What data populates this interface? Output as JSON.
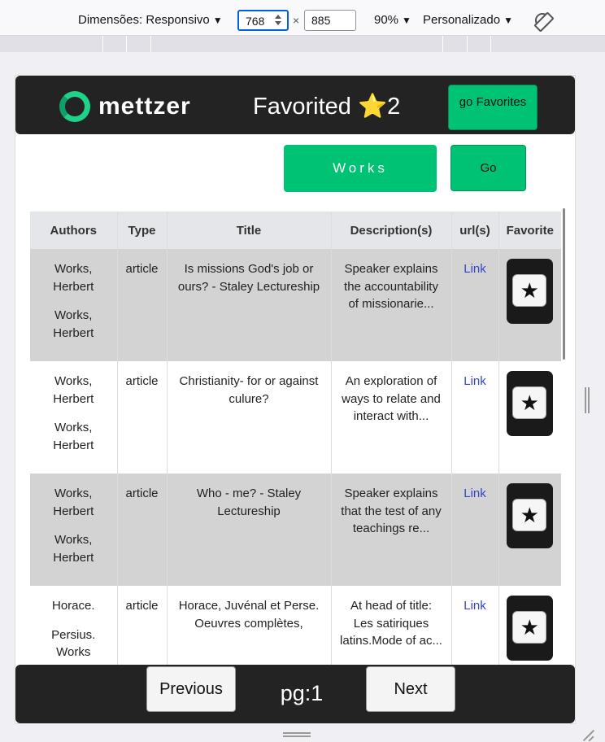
{
  "devtools": {
    "dimensions_label": "Dimensões: Responsivo",
    "width": "768",
    "height": "885",
    "times": "×",
    "zoom": "90%",
    "preset": "Personalizado",
    "caret": "▼"
  },
  "app": {
    "logo_text": "mettzer",
    "favorited_label": "Favorited",
    "favorited_star": "⭐",
    "favorited_count": "2",
    "go_favorites": "go Favorites",
    "search_value": "Works",
    "go_label": "Go"
  },
  "table": {
    "headers": [
      "Authors",
      "Type",
      "Title",
      "Description(s)",
      "url(s)",
      "Favorite"
    ],
    "rows": [
      {
        "authors": [
          "Works, Herbert",
          "Works, Herbert"
        ],
        "type": "article",
        "title": "Is missions God's job or ours? - Staley Lectureship",
        "description": "Speaker explains the accountability of missionarie...",
        "url": "Link",
        "fav_icon": "★"
      },
      {
        "authors": [
          "Works, Herbert",
          "Works, Herbert"
        ],
        "type": "article",
        "title": "Christianity- for or against culure?",
        "description": "An exploration of ways to relate and interact with...",
        "url": "Link",
        "fav_icon": "★"
      },
      {
        "authors": [
          "Works, Herbert",
          "Works, Herbert"
        ],
        "type": "article",
        "title": "Who - me? - Staley Lectureship",
        "description": "Speaker explains that the test of any teachings re...",
        "url": "Link",
        "fav_icon": "★"
      },
      {
        "authors": [
          "Horace.",
          "Persius. Works"
        ],
        "type": "article",
        "title": "Horace, Juvénal et Perse. Oeuvres complètes,",
        "description": "At head of title: Les satiriques latins.Mode of ac...",
        "url": "Link",
        "fav_icon": "★"
      }
    ]
  },
  "pagination": {
    "previous": "Previous",
    "page": "pg:1",
    "next": "Next"
  }
}
